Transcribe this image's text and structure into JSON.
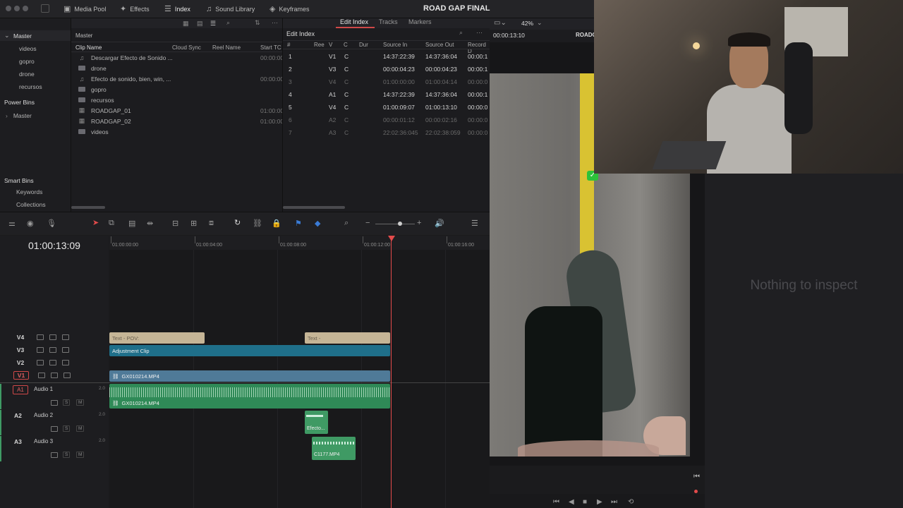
{
  "app": {
    "project_title": "ROAD GAP FINAL"
  },
  "topbar": {
    "tabs": [
      {
        "label": "Media Pool",
        "icon": "media-pool-icon"
      },
      {
        "label": "Effects",
        "icon": "effects-icon"
      },
      {
        "label": "Index",
        "icon": "index-icon"
      },
      {
        "label": "Sound Library",
        "icon": "sound-library-icon"
      },
      {
        "label": "Keyframes",
        "icon": "keyframes-icon"
      }
    ]
  },
  "bins": {
    "master_label": "Master",
    "items": [
      "videos",
      "gopro",
      "drone",
      "recursos"
    ],
    "power_bins_label": "Power Bins",
    "power_master": "Master",
    "smart_bins_label": "Smart Bins",
    "smart_items": [
      "Keywords",
      "Collections"
    ]
  },
  "media_pool": {
    "header": "Master",
    "columns": [
      "Clip Name",
      "Cloud Sync",
      "Reel Name",
      "Start TC"
    ],
    "rows": [
      {
        "name": "Descargar Efecto de Sonido ...",
        "type": "audio",
        "start": "00:00:00"
      },
      {
        "name": "drone",
        "type": "folder",
        "start": ""
      },
      {
        "name": "Efecto de sonido, bien, win, ...",
        "type": "audio",
        "start": "00:00:00"
      },
      {
        "name": "gopro",
        "type": "folder",
        "start": ""
      },
      {
        "name": "recursos",
        "type": "folder",
        "start": ""
      },
      {
        "name": "ROADGAP_01",
        "type": "timeline",
        "start": "01:00:00"
      },
      {
        "name": "ROADGAP_02",
        "type": "timeline",
        "start": "01:00:00"
      },
      {
        "name": "videos",
        "type": "folder",
        "start": ""
      }
    ]
  },
  "edit_index": {
    "tabs": [
      "Edit Index",
      "Tracks",
      "Markers"
    ],
    "title": "Edit Index",
    "columns": [
      "#",
      "Ree",
      "V",
      "C",
      "Dur",
      "Source In",
      "Source Out",
      "Record D"
    ],
    "rows": [
      {
        "n": "1",
        "v": "V1",
        "c": "C",
        "in": "14:37:22:39",
        "out": "14:37:36:04",
        "rec": "00:00:1",
        "dim": false
      },
      {
        "n": "2",
        "v": "V3",
        "c": "C",
        "in": "00:00:04:23",
        "out": "00:00:04:23",
        "rec": "00:00:1",
        "dim": false
      },
      {
        "n": "3",
        "v": "V4",
        "c": "C",
        "in": "01:00:00:00",
        "out": "01:00:04:14",
        "rec": "00:00:0",
        "dim": true
      },
      {
        "n": "4",
        "v": "A1",
        "c": "C",
        "in": "14:37:22:39",
        "out": "14:37:36:04",
        "rec": "00:00:1",
        "dim": false
      },
      {
        "n": "5",
        "v": "V4",
        "c": "C",
        "in": "01:00:09:07",
        "out": "01:00:13:10",
        "rec": "00:00:0",
        "dim": false
      },
      {
        "n": "6",
        "v": "A2",
        "c": "C",
        "in": "00:00:01:12",
        "out": "00:00:02:16",
        "rec": "00:00:0",
        "dim": true
      },
      {
        "n": "7",
        "v": "A3",
        "c": "C",
        "in": "22:02:36:045",
        "out": "22:02:38:059",
        "rec": "00:00:0",
        "dim": true
      }
    ]
  },
  "viewer": {
    "zoom": "42%",
    "timecode": "00:00:13:10",
    "title": "ROADG"
  },
  "inspector": {
    "empty_text": "Nothing to inspect"
  },
  "timeline": {
    "current_tc": "01:00:13:09",
    "ruler": [
      "01:00:00:00",
      "01:00:04:00",
      "01:00:08:00",
      "01:00:12:00",
      "01:00:16:00"
    ],
    "tracks": [
      {
        "id": "V4",
        "name": ""
      },
      {
        "id": "V3",
        "name": ""
      },
      {
        "id": "V2",
        "name": ""
      },
      {
        "id": "V1",
        "name": ""
      },
      {
        "id": "A1",
        "name": "Audio 1",
        "level": "2.0"
      },
      {
        "id": "A2",
        "name": "Audio 2",
        "level": "2.0"
      },
      {
        "id": "A3",
        "name": "Audio 3",
        "level": "2.0"
      }
    ],
    "solo": "S",
    "mute": "M",
    "clips": {
      "v4a": "Text - POV:",
      "v4b": "Text -",
      "v3": "Adjustment Clip",
      "v1": "GX010214.MP4",
      "a1": "GX010214.MP4",
      "a2": "Efecto...",
      "a3": "C1177.MP4"
    }
  },
  "colors": {
    "accent": "#e34b4b",
    "video_clip": "#4f7a98",
    "adjust_clip": "#1f6f8a",
    "text_clip": "#c5b596",
    "audio_clip": "#3f9a64"
  }
}
